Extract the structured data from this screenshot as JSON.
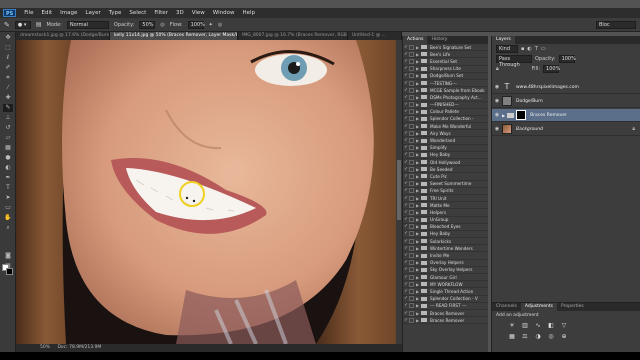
{
  "menubar": {
    "logo": "PS",
    "items": [
      "File",
      "Edit",
      "Image",
      "Layer",
      "Type",
      "Select",
      "Filter",
      "3D",
      "View",
      "Window",
      "Help"
    ]
  },
  "options": {
    "mode_label": "Mode:",
    "mode": "Normal",
    "opacity_label": "Opacity:",
    "opacity": "50%",
    "flow_label": "Flow:",
    "flow": "100%",
    "workspace": "Bloc"
  },
  "doc_tabs": [
    {
      "label": "dreamstock1.jpg @ 17.6% (Dodge/Burn, RGB/..."
    },
    {
      "label": "kelly 11x14.jpg @ 50% (Braces Remover, Layer Mask/8) *"
    },
    {
      "label": "IMG_8007.jpg @ 16.7% (Braces Remover, RGB/8) *"
    },
    {
      "label": "Untitled-1 @ ..."
    }
  ],
  "status": {
    "zoom": "50%",
    "doc": "Doc: 78.9M/213.9M"
  },
  "actions_panel": {
    "tabs": [
      "Actions",
      "History"
    ],
    "items": [
      "Bee's Signature Set",
      "Bee's Life",
      "Essential Set",
      "Sharpness Lite",
      "Dodge/Burn Set",
      "---TESTING---",
      "MCGE Sample from Ebook",
      "DSMs Photography Act...",
      "---FINISHED---",
      "Colour Pallete",
      "Splendor Collection -",
      "Make Me Wonderful",
      "Airy Ways",
      "Wonderland",
      "Simplify",
      "Hey Baby",
      "Old Hollywood",
      "Be Seeded",
      "Cute Pic",
      "Sweet Summertime",
      "Free Spirits",
      "TRI Unit",
      "Matte Me",
      "Helpers",
      "UnGroup",
      "Bleached Eyes",
      "Hey Baby",
      "Solarkicks",
      "Wintertime Wonders",
      "Invite Me",
      "Overlay Helpers",
      "Sky Overlay Helpers",
      "Glamour Girl",
      "MY WORKFLOW",
      "Single Thread Action",
      "Splendor Collection - V",
      "--- READ FIRST ---",
      "Braces Remover",
      "Braces Remover"
    ]
  },
  "layers_panel": {
    "tabs": [
      "Layers"
    ],
    "kind": "Kind",
    "blend": "Pass Through",
    "opacity_label": "Opacity:",
    "opacity": "100%",
    "fill_label": "Fill:",
    "fill": "100%",
    "layers": [
      {
        "name": "www.48hrspixelimages.com",
        "type": "text"
      },
      {
        "name": "Dodge/Burn",
        "type": "gray"
      },
      {
        "name": "Braces Remover",
        "type": "group-mask"
      },
      {
        "name": "Background",
        "type": "image"
      }
    ]
  },
  "adjust_panel": {
    "tabs": [
      "Channels",
      "Adjustments",
      "Properties"
    ],
    "heading": "Add an adjustment"
  }
}
